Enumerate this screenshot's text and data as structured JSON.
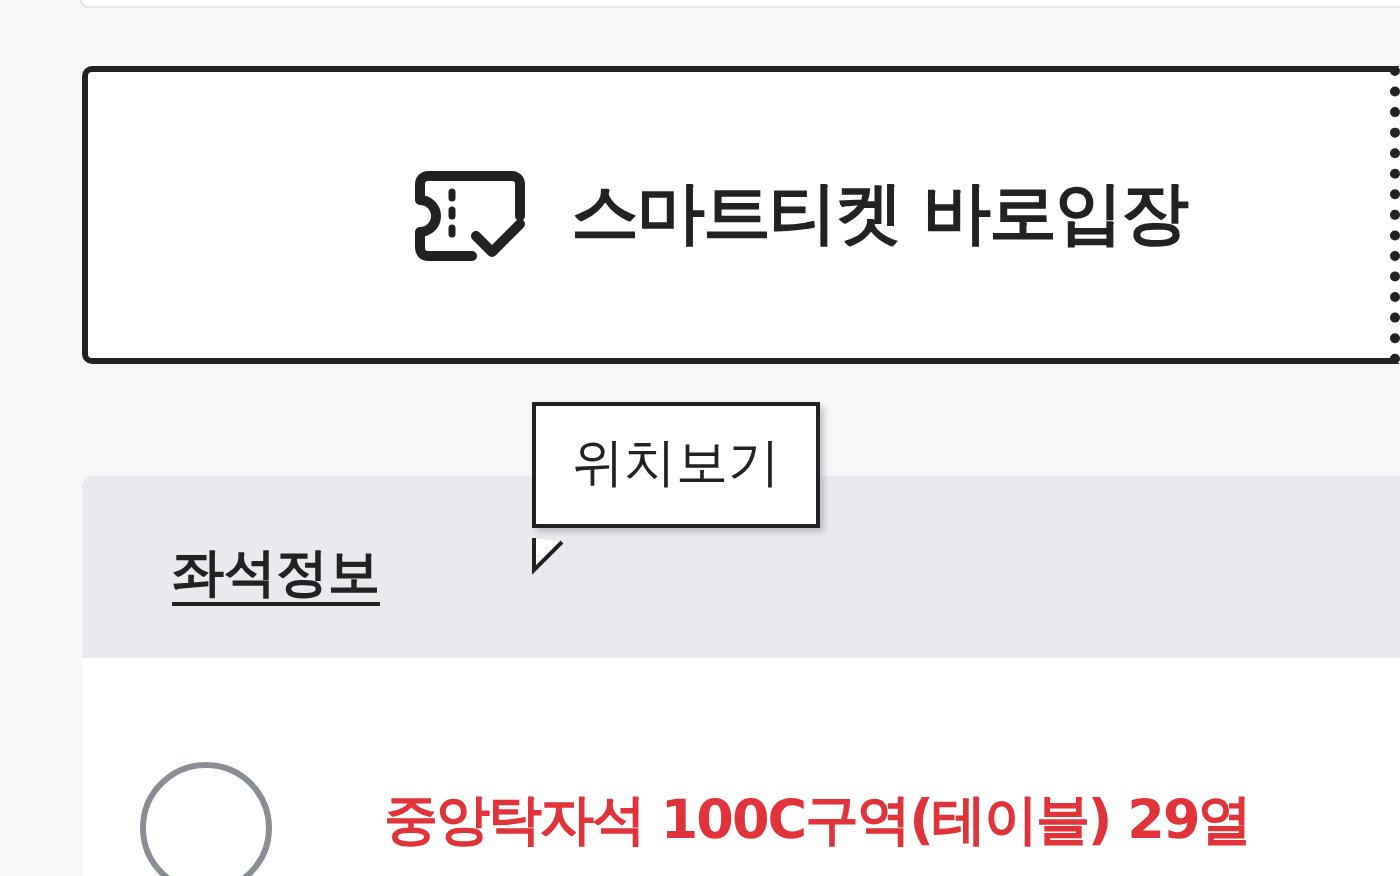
{
  "smart_ticket_button": {
    "label": "스마트티켓 바로입장"
  },
  "tooltip": {
    "text": "위치보기"
  },
  "seat_info": {
    "title": "좌석정보",
    "seats": [
      {
        "text": "중앙탁자석 100C구역(테이블) 29열",
        "selected": false
      }
    ]
  }
}
